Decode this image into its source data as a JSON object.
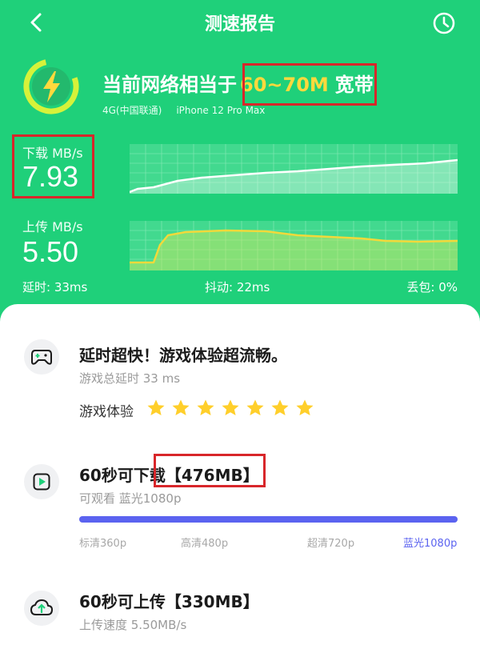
{
  "header": {
    "title": "测速报告",
    "network_prefix": "当前网络相当于",
    "network_range": "60~70M",
    "network_suffix": "宽带",
    "network_type": "4G(中国联通)",
    "device": "iPhone 12 Pro Max"
  },
  "download": {
    "label": "下载 MB/s",
    "value": "7.93"
  },
  "upload": {
    "label": "上传 MB/s",
    "value": "5.50"
  },
  "stats": {
    "latency": "延时: 33ms",
    "jitter": "抖动: 22ms",
    "loss": "丢包: 0%"
  },
  "gaming": {
    "title": "延时超快！游戏体验超流畅。",
    "subtitle": "游戏总延时 33 ms",
    "experience_label": "游戏体验",
    "stars": 7
  },
  "download_60s": {
    "title_prefix": "60秒可下载",
    "amount": "【476MB】",
    "subtitle": "可观看 蓝光1080p",
    "progress": 1.0,
    "quality_labels": [
      "标清360p",
      "高清480p",
      "超清720p",
      "蓝光1080p"
    ]
  },
  "upload_60s": {
    "title": "60秒可上传【330MB】",
    "subtitle": "上传速度 5.50MB/s"
  },
  "colors": {
    "brand_green": "#1fd07a",
    "accent_yellow": "#ffd93d",
    "progress_blue": "#5b63f0",
    "highlight_red": "#d8262a"
  },
  "icons": [
    "back-arrow-icon",
    "history-clock-icon",
    "lightning-bolt-icon",
    "gamepad-icon",
    "play-video-icon",
    "cloud-upload-icon",
    "star-icon"
  ]
}
